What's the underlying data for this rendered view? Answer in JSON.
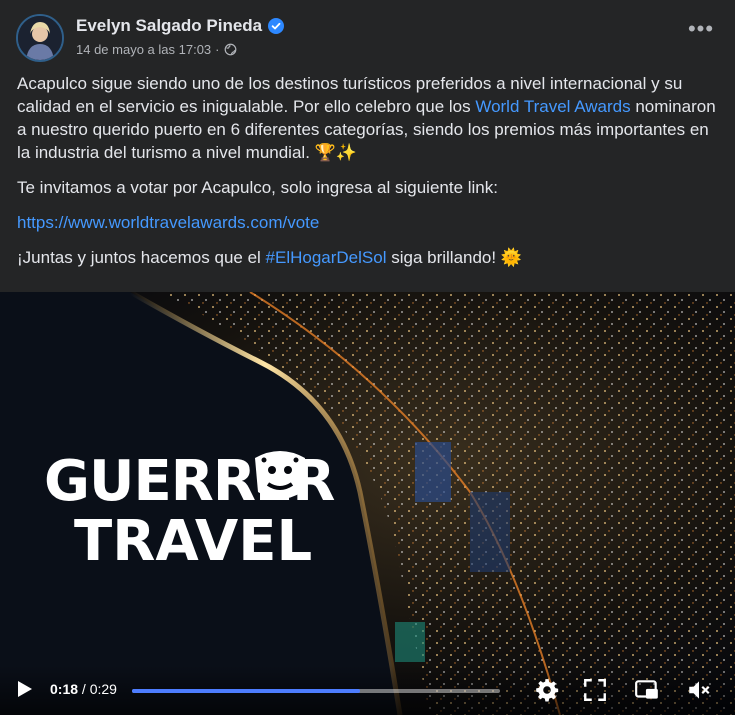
{
  "post": {
    "author": "Evelyn Salgado Pineda",
    "timestamp": "14 de mayo a las 17:03",
    "separator": "·",
    "verified_icon": "verified-badge-icon",
    "privacy_icon": "globe-icon",
    "more_label": "•••"
  },
  "text": {
    "p1_a": "Acapulco sigue siendo uno de los destinos turísticos preferidos a nivel internacional y su  calidad en el servicio es inigualable. Por ello celebro que los ",
    "p1_link": "World Travel Awards",
    "p1_b": " nominaron a nuestro querido puerto en 6 diferentes categorías, siendo los premios más importantes en la industria del turismo a nivel mundial. ",
    "p1_emoji": "🏆✨",
    "p2": "Te invitamos a votar por Acapulco, solo ingresa al siguiente link:",
    "p3_link": "https://www.worldtravelawards.com/vote",
    "p4_a": "¡Juntas y juntos hacemos que el ",
    "p4_hashtag": "#ElHogarDelSol",
    "p4_b": " siga brillando! ",
    "p4_emoji": "🌞"
  },
  "video": {
    "logo_line1": "GUERRER",
    "logo_line2": "TRAVEL",
    "current_time": "0:18",
    "time_sep": " / ",
    "duration": "0:29",
    "progress": 0.62,
    "accent": "#4d7dff"
  },
  "colors": {
    "background": "#242526",
    "text": "#e4e6eb",
    "secondary": "#b0b3b8",
    "link": "#4599ff"
  }
}
